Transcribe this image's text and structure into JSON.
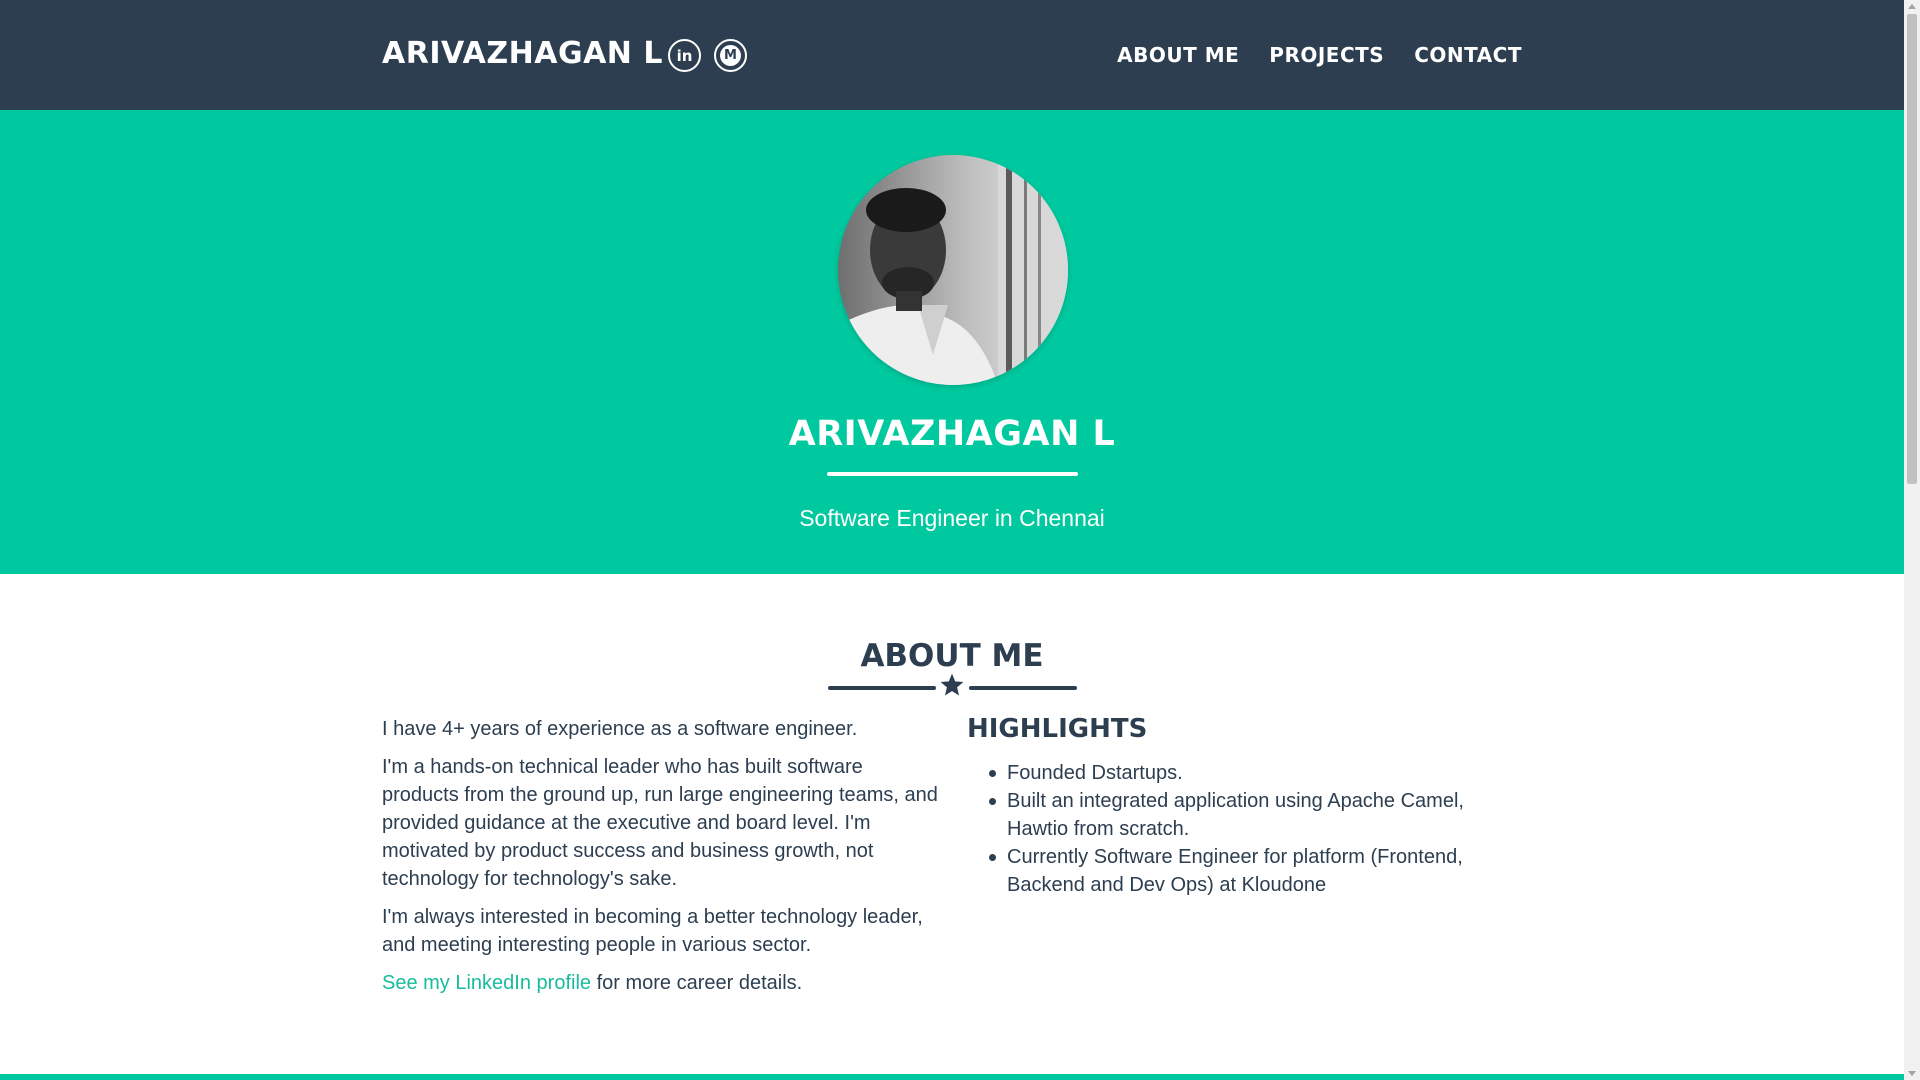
{
  "navbar": {
    "brand": "ARIVAZHAGAN L",
    "social": [
      {
        "icon": "linkedin-icon",
        "glyph": "in"
      },
      {
        "icon": "medium-icon",
        "glyph": "M"
      }
    ],
    "links": [
      "ABOUT ME",
      "PROJECTS",
      "CONTACT"
    ]
  },
  "masthead": {
    "name": "ARIVAZHAGAN L",
    "subtitle": "Software Engineer in Chennai"
  },
  "about": {
    "heading": "ABOUT ME",
    "paragraphs": [
      "I have 4+ years of experience as a software engineer.",
      "I'm a hands-on technical leader who has built software products from the ground up, run large engineering teams, and provided guidance at the executive and board level. I'm motivated by product success and business growth, not technology for technology's sake.",
      "I'm always interested in becoming a better technology leader, and meeting interesting people in various sector."
    ],
    "linkedin_link": "See my LinkedIn profile",
    "linkedin_suffix": " for more career details.",
    "highlights_heading": "HIGHLIGHTS",
    "highlights": [
      "Founded Dstartups.",
      "Built an integrated application using Apache Camel, Hawtio from scratch.",
      "Currently Software Engineer for platform (Frontend, Backend and Dev Ops) at Kloudone"
    ]
  },
  "colors": {
    "navbar": "#2c3e50",
    "accent": "#00c89f",
    "link": "#18bc9c",
    "text": "#2c3e50"
  }
}
